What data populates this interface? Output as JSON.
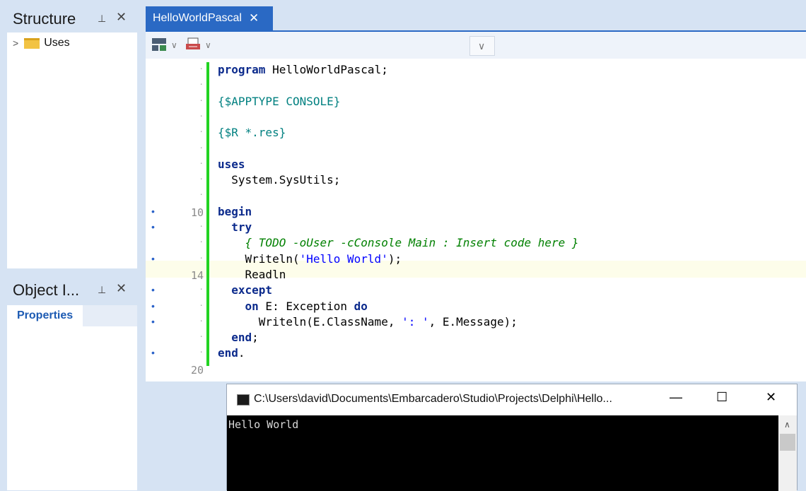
{
  "structure_panel": {
    "title": "Structure",
    "tree": [
      {
        "label": "Uses",
        "icon": "folder-icon"
      }
    ]
  },
  "object_inspector": {
    "title": "Object I...",
    "tab": "Properties"
  },
  "editor": {
    "tab_title": "HelloWorldPascal",
    "lines": [
      {
        "num": "",
        "mark": "",
        "html": "<span class='kw'>program</span> HelloWorldPascal;"
      },
      {
        "num": "",
        "mark": "",
        "html": ""
      },
      {
        "num": "",
        "mark": "",
        "html": "<span class='dir'>{$APPTYPE CONSOLE}</span>"
      },
      {
        "num": "",
        "mark": "",
        "html": ""
      },
      {
        "num": "",
        "mark": "",
        "html": "<span class='dir'>{$R *.res}</span>"
      },
      {
        "num": "",
        "mark": "",
        "html": ""
      },
      {
        "num": "",
        "mark": "",
        "html": "<span class='kw'>uses</span>"
      },
      {
        "num": "",
        "mark": "",
        "html": "  System.SysUtils;"
      },
      {
        "num": "",
        "mark": "",
        "html": ""
      },
      {
        "num": "10",
        "mark": "•",
        "html": "<span class='kw'>begin</span>"
      },
      {
        "num": "",
        "mark": "•",
        "html": "  <span class='kw'>try</span>"
      },
      {
        "num": "",
        "mark": "",
        "html": "    <span class='cmt'>{ TODO -oUser -cConsole Main : Insert code here }</span>"
      },
      {
        "num": "",
        "mark": "•",
        "html": "    Writeln(<span class='str'>'Hello World'</span>);"
      },
      {
        "num": "14",
        "mark": "",
        "html": "    Readln"
      },
      {
        "num": "",
        "mark": "•",
        "html": "  <span class='kw'>except</span>"
      },
      {
        "num": "",
        "mark": "•",
        "html": "    <span class='kw'>on</span> E: Exception <span class='kw'>do</span>"
      },
      {
        "num": "",
        "mark": "•",
        "html": "      Writeln(E.ClassName, <span class='str'>': '</span>, E.Message);"
      },
      {
        "num": "",
        "mark": "",
        "html": "  <span class='kw'>end</span>;"
      },
      {
        "num": "",
        "mark": "•",
        "html": "<span class='kw'>end</span>."
      },
      {
        "num": "20",
        "mark": "",
        "html": ""
      }
    ]
  },
  "console": {
    "title": "C:\\Users\\david\\Documents\\Embarcadero\\Studio\\Projects\\Delphi\\Hello...",
    "output": "Hello World",
    "minimize": "—",
    "maximize": "☐",
    "close": "✕"
  },
  "colors": {
    "accent": "#2a69c4",
    "change_bar": "#22d322"
  }
}
